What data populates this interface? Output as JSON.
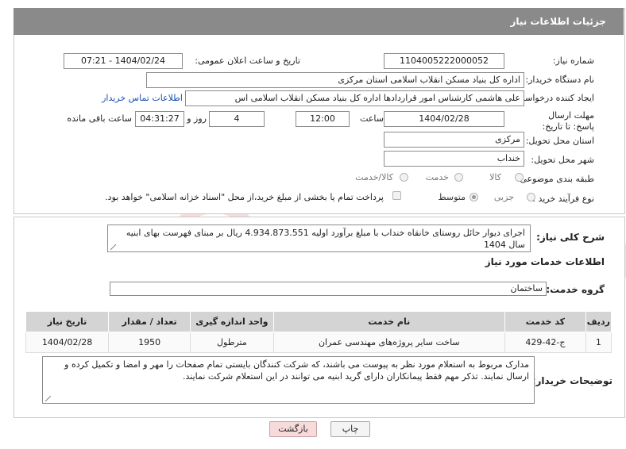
{
  "header": {
    "title": "جزئیات اطلاعات نیاز"
  },
  "fields": {
    "need_number_label": "شماره نیاز:",
    "need_number": "1104005222000052",
    "announce_label": "تاریخ و ساعت اعلان عمومی:",
    "announce_value": "1404/02/24 - 07:21",
    "buyer_org_label": "نام دستگاه خریدار:",
    "buyer_org": "اداره کل بنیاد مسکن انقلاب اسلامی استان مرکزی",
    "creator_label": "ایجاد کننده درخواست:",
    "creator": "علی هاشمی کارشناس امور قراردادها اداره کل بنیاد مسکن انقلاب اسلامی اس",
    "contact_link": "اطلاعات تماس خریدار",
    "deadline_label": "مهلت ارسال پاسخ: تا تاریخ:",
    "deadline_date": "1404/02/28",
    "time_label": "ساعت",
    "deadline_time": "12:00",
    "days_value": "4",
    "days_label": "روز و",
    "remaining_time": "04:31:27",
    "remaining_label": "ساعت باقی مانده",
    "province_label": "استان محل تحویل:",
    "province": "مرکزی",
    "city_label": "شهر محل تحویل:",
    "city": "خنداب",
    "category_label": "طبقه بندی موضوعی:",
    "category_options": [
      "کالا",
      "خدمت",
      "کالا/خدمت"
    ],
    "process_label": "نوع فرآیند خرید :",
    "process_options": [
      "جزیی",
      "متوسط"
    ],
    "payment_note": "پرداخت تمام یا بخشی از مبلغ خرید،از محل \"اسناد خزانه اسلامی\" خواهد بود."
  },
  "description": {
    "label": "شرح کلی نیاز:",
    "text": "اجرای دیوار حائل روستای خانقاه خنداب  با مبلغ برآورد اولیه  4.934.873.551 ریال بر مبنای فهرست بهای ابنیه سال 1404"
  },
  "services": {
    "section_title": "اطلاعات خدمات مورد نیاز",
    "group_label": "گروه خدمت:",
    "group_value": "ساختمان",
    "columns": [
      "ردیف",
      "کد خدمت",
      "نام خدمت",
      "واحد اندازه گیری",
      "تعداد / مقدار",
      "تاریخ نیاز"
    ],
    "rows": [
      [
        "1",
        "ج-42-429",
        "ساخت سایر پروژه‌های مهندسی عمران",
        "مترطول",
        "1950",
        "1404/02/28"
      ]
    ]
  },
  "buyer_notes": {
    "label": "توضیحات خریدار:",
    "text": "مدارک مربوط به استعلام مورد نظر به پیوست می باشند، که شرکت کنندگان بایستی تمام صفحات را مهر و امضا و تکمیل کرده و ارسال نمایند. تذکر مهم فقط پیمانکاران دارای گرید ابنیه می توانند در این استعلام شرکت نمایند."
  },
  "buttons": {
    "print": "چاپ",
    "back": "بازگشت"
  },
  "watermark": {
    "text": "AriaTender.net"
  },
  "colors": {
    "titlebar": "#8a8a8a",
    "link": "#1a4fb5",
    "back_button": "#f7dada",
    "table_header": "#d4d4d4"
  }
}
